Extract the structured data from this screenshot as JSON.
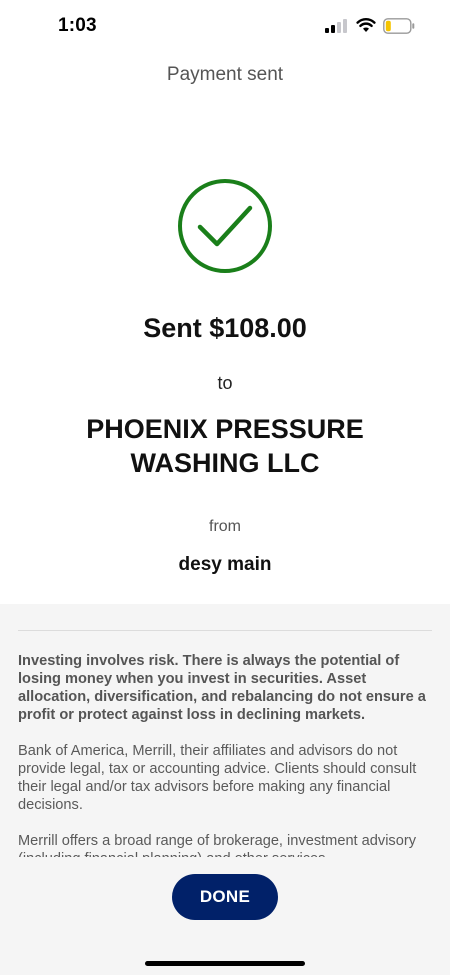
{
  "status_bar": {
    "time": "1:03",
    "signal_icon": "cellular-signal-icon",
    "wifi_icon": "wifi-icon",
    "battery_icon": "battery-low-icon",
    "battery_color": "#f5c400"
  },
  "header": {
    "title": "Payment sent"
  },
  "confirmation": {
    "icon": "checkmark-circle-icon",
    "icon_color": "#1a7f1a",
    "amount_text": "Sent $108.00",
    "to_label": "to",
    "recipient": "PHOENIX PRESSURE WASHING LLC",
    "from_label": "from",
    "source_account": "desy main"
  },
  "disclosures": [
    "Investing involves risk. There is always the potential of losing money when you invest in securities. Asset allocation, diversification, and rebalancing do not ensure a profit or protect against loss in declining markets.",
    "Bank of America, Merrill, their affiliates and advisors do not provide legal, tax or accounting advice. Clients should consult their legal and/or tax advisors before making any financial decisions.",
    "Merrill offers a broad range of brokerage, investment advisory (including financial planning) and other services"
  ],
  "actions": {
    "done_label": "DONE",
    "done_color": "#012169"
  }
}
